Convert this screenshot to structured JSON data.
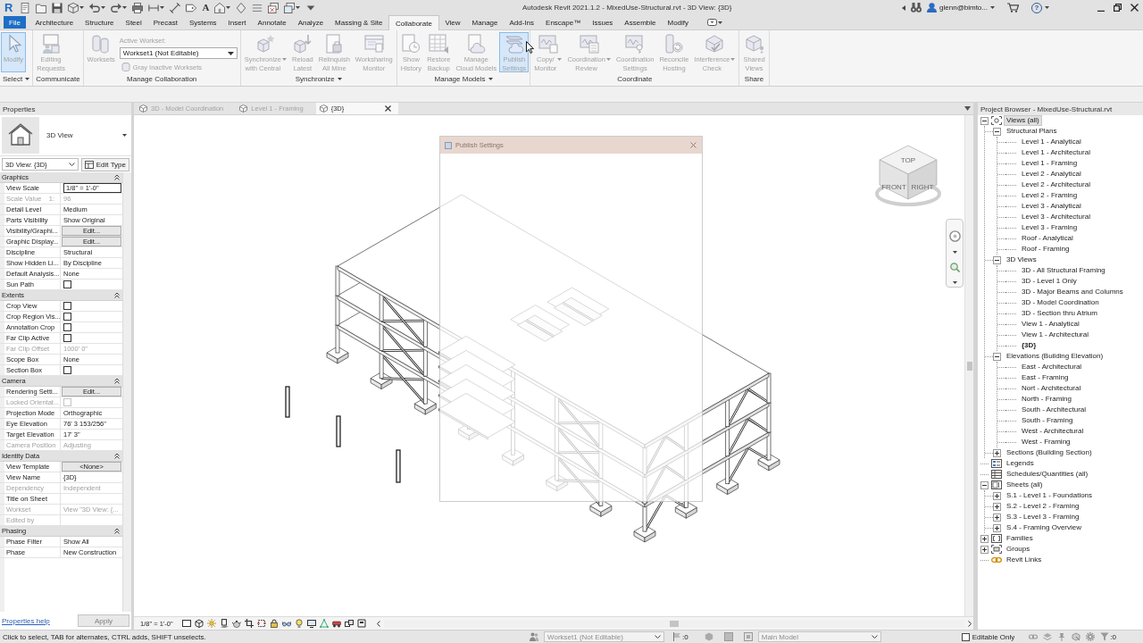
{
  "title_bar": {
    "logo": "R",
    "quick_access": [
      {
        "kind": "recent",
        "menu": false
      },
      {
        "kind": "open",
        "menu": false
      },
      {
        "kind": "save",
        "menu": false
      },
      {
        "kind": "sync",
        "menu": true
      },
      {
        "kind": "undo",
        "menu": true
      },
      {
        "kind": "redo",
        "menu": true
      },
      {
        "kind": "print",
        "menu": false
      },
      {
        "kind": "measure",
        "menu": true
      },
      {
        "kind": "dimension",
        "menu": false
      },
      {
        "kind": "tag",
        "menu": false
      },
      {
        "kind": "text",
        "glyph": "A",
        "menu": false
      },
      {
        "kind": "view3d",
        "menu": true
      },
      {
        "kind": "section",
        "menu": false
      },
      {
        "kind": "thinlines",
        "menu": false
      },
      {
        "kind": "closewindows",
        "menu": false
      },
      {
        "kind": "switchwindows",
        "menu": true
      },
      {
        "kind": "customize",
        "menu": false
      }
    ],
    "title": "Autodesk Revit 2021.1.2 - MixedUse-Structural.rvt - 3D View: {3D}",
    "user": "glenn@bimto...",
    "help": "?"
  },
  "ribbon": {
    "tabs": [
      {
        "label": "File",
        "kind": "app",
        "selected": false
      },
      {
        "label": "Architecture",
        "kind": "tab",
        "selected": false
      },
      {
        "label": "Structure",
        "kind": "tab",
        "selected": false
      },
      {
        "label": "Steel",
        "kind": "tab",
        "selected": false
      },
      {
        "label": "Precast",
        "kind": "tab",
        "selected": false
      },
      {
        "label": "Systems",
        "kind": "tab",
        "selected": false
      },
      {
        "label": "Insert",
        "kind": "tab",
        "selected": false
      },
      {
        "label": "Annotate",
        "kind": "tab",
        "selected": false
      },
      {
        "label": "Analyze",
        "kind": "tab",
        "selected": false
      },
      {
        "label": "Massing & Site",
        "kind": "tab",
        "selected": false
      },
      {
        "label": "Collaborate",
        "kind": "tab",
        "selected": true
      },
      {
        "label": "View",
        "kind": "tab",
        "selected": false
      },
      {
        "label": "Manage",
        "kind": "tab",
        "selected": false
      },
      {
        "label": "Add-Ins",
        "kind": "tab",
        "selected": false
      },
      {
        "label": "Enscape™",
        "kind": "tab",
        "selected": false
      },
      {
        "label": "Issues",
        "kind": "tab",
        "selected": false
      },
      {
        "label": "Assemble",
        "kind": "tab",
        "selected": false
      },
      {
        "label": "Modify",
        "kind": "tab",
        "selected": false
      }
    ],
    "panels": [
      {
        "label": "Select",
        "menu": true,
        "buttons": [
          {
            "label": "Modify",
            "kind": "large",
            "disabled": true,
            "highlighted": true,
            "menu": false
          }
        ]
      },
      {
        "label": "Communicate",
        "menu": false,
        "buttons": [
          {
            "label": "Editing\nRequests",
            "kind": "large",
            "disabled": true,
            "highlighted": false,
            "menu": false
          }
        ]
      },
      {
        "label": "Manage Collaboration",
        "menu": false,
        "buttons": [
          {
            "label": "Worksets",
            "kind": "large",
            "disabled": true,
            "highlighted": false,
            "menu": false
          },
          {
            "label": "Active Workset:",
            "kind": "caption",
            "disabled": true,
            "highlighted": false,
            "menu": false
          },
          {
            "label": "Workset1 (Not Editable)",
            "kind": "dropdown",
            "disabled": false,
            "highlighted": false,
            "menu": true
          },
          {
            "label": "Gray Inactive Worksets",
            "kind": "small",
            "disabled": true,
            "highlighted": false,
            "menu": false
          }
        ]
      },
      {
        "label": "Synchronize",
        "menu": true,
        "buttons": [
          {
            "label": "Synchronize\nwith Central",
            "kind": "large",
            "disabled": true,
            "highlighted": false,
            "menu": true
          },
          {
            "label": "Reload\nLatest",
            "kind": "large",
            "disabled": true,
            "highlighted": false,
            "menu": false
          },
          {
            "label": "Relinquish\nAll Mine",
            "kind": "large",
            "disabled": true,
            "highlighted": false,
            "menu": false
          },
          {
            "label": "Worksharing\nMonitor",
            "kind": "large",
            "disabled": true,
            "highlighted": false,
            "menu": false
          }
        ]
      },
      {
        "label": "Manage Models",
        "menu": true,
        "buttons": [
          {
            "label": "Show\nHistory",
            "kind": "large",
            "disabled": true,
            "highlighted": false,
            "menu": false
          },
          {
            "label": "Restore\nBackup",
            "kind": "large",
            "disabled": true,
            "highlighted": false,
            "menu": false
          },
          {
            "label": "Manage\nCloud Models",
            "kind": "large",
            "disabled": true,
            "highlighted": false,
            "menu": false
          },
          {
            "label": "Publish\nSettings",
            "kind": "large",
            "disabled": true,
            "highlighted": true,
            "menu": false
          }
        ]
      },
      {
        "label": "Coordinate",
        "menu": false,
        "buttons": [
          {
            "label": "Copy/\nMonitor",
            "kind": "large",
            "disabled": true,
            "highlighted": false,
            "menu": true
          },
          {
            "label": "Coordination\nReview",
            "kind": "large",
            "disabled": true,
            "highlighted": false,
            "menu": true
          },
          {
            "label": "Coordination\nSettings",
            "kind": "large",
            "disabled": true,
            "highlighted": false,
            "menu": false
          },
          {
            "label": "Reconcile\nHosting",
            "kind": "large",
            "disabled": true,
            "highlighted": false,
            "menu": false
          },
          {
            "label": "Interference\nCheck",
            "kind": "large",
            "disabled": true,
            "highlighted": false,
            "menu": true
          }
        ]
      },
      {
        "label": "Share",
        "menu": false,
        "buttons": [
          {
            "label": "Shared\nViews",
            "kind": "large",
            "disabled": true,
            "highlighted": false,
            "menu": false
          }
        ]
      }
    ]
  },
  "properties": {
    "title": "Properties",
    "type_name": "3D View",
    "instance": "3D View: {3D}",
    "edit_type": "Edit Type",
    "groups": [
      {
        "name": "Graphics",
        "expanded": true,
        "rows": [
          {
            "name": "View Scale",
            "kind": "field",
            "value": "1/8\" = 1'-0\"",
            "disabled": false
          },
          {
            "name": "Scale Value    1:",
            "kind": "text",
            "value": "96",
            "disabled": true
          },
          {
            "name": "Detail Level",
            "kind": "text",
            "value": "Medium",
            "disabled": false
          },
          {
            "name": "Parts Visibility",
            "kind": "text",
            "value": "Show Original",
            "disabled": false
          },
          {
            "name": "Visibility/Graphi...",
            "kind": "button",
            "value": "Edit...",
            "disabled": false
          },
          {
            "name": "Graphic Display...",
            "kind": "button",
            "value": "Edit...",
            "disabled": false
          },
          {
            "name": "Discipline",
            "kind": "text",
            "value": "Structural",
            "disabled": false
          },
          {
            "name": "Show Hidden Li...",
            "kind": "text",
            "value": "By Discipline",
            "disabled": false
          },
          {
            "name": "Default Analysis...",
            "kind": "text",
            "value": "None",
            "disabled": false
          },
          {
            "name": "Sun Path",
            "kind": "checkbox",
            "checked": false,
            "disabled": false
          }
        ]
      },
      {
        "name": "Extents",
        "expanded": true,
        "rows": [
          {
            "name": "Crop View",
            "kind": "checkbox",
            "checked": false,
            "disabled": false
          },
          {
            "name": "Crop Region Vis...",
            "kind": "checkbox",
            "checked": false,
            "disabled": false
          },
          {
            "name": "Annotation Crop",
            "kind": "checkbox",
            "checked": false,
            "disabled": false
          },
          {
            "name": "Far Clip Active",
            "kind": "checkbox",
            "checked": false,
            "disabled": false
          },
          {
            "name": "Far Clip Offset",
            "kind": "text",
            "value": "1000' 0\"",
            "disabled": true
          },
          {
            "name": "Scope Box",
            "kind": "text",
            "value": "None",
            "disabled": false
          },
          {
            "name": "Section Box",
            "kind": "checkbox",
            "checked": false,
            "disabled": false
          }
        ]
      },
      {
        "name": "Camera",
        "expanded": true,
        "rows": [
          {
            "name": "Rendering Setti...",
            "kind": "button",
            "value": "Edit...",
            "disabled": false
          },
          {
            "name": "Locked Orientat...",
            "kind": "checkbox",
            "checked": false,
            "disabled": true
          },
          {
            "name": "Projection Mode",
            "kind": "text",
            "value": "Orthographic",
            "disabled": false
          },
          {
            "name": "Eye Elevation",
            "kind": "text",
            "value": "76' 3 153/256\"",
            "disabled": false
          },
          {
            "name": "Target Elevation",
            "kind": "text",
            "value": "17' 3\"",
            "disabled": false
          },
          {
            "name": "Camera Position",
            "kind": "text",
            "value": "Adjusting",
            "disabled": true
          }
        ]
      },
      {
        "name": "Identity Data",
        "expanded": true,
        "rows": [
          {
            "name": "View Template",
            "kind": "button",
            "value": "<None>",
            "disabled": false
          },
          {
            "name": "View Name",
            "kind": "text",
            "value": "{3D}",
            "disabled": false
          },
          {
            "name": "Dependency",
            "kind": "text",
            "value": "Independent",
            "disabled": true
          },
          {
            "name": "Title on Sheet",
            "kind": "text",
            "disabled": false
          },
          {
            "name": "Workset",
            "kind": "text",
            "value": "View \"3D View: {...",
            "disabled": true
          },
          {
            "name": "Edited by",
            "kind": "text",
            "disabled": true
          }
        ]
      },
      {
        "name": "Phasing",
        "expanded": true,
        "rows": [
          {
            "name": "Phase Filter",
            "kind": "text",
            "value": "Show All",
            "disabled": false
          },
          {
            "name": "Phase",
            "kind": "text",
            "value": "New Construction",
            "disabled": false
          }
        ]
      }
    ],
    "help_link": "Properties help",
    "apply": {
      "label": "Apply",
      "disabled": true
    }
  },
  "view": {
    "tabs": [
      {
        "label": "3D - Model Coordination",
        "selected": false
      },
      {
        "label": "Level 1 - Framing",
        "selected": false
      },
      {
        "label": "{3D}",
        "selected": true
      }
    ],
    "dialog": {
      "title": "Publish Settings"
    },
    "view_cube": {
      "faces": [
        "TOP",
        "FRONT",
        "RIGHT"
      ]
    },
    "scale": "1/8\" = 1'-0\""
  },
  "project_browser": {
    "title": "Project Browser - MixedUse-Structural.rvt",
    "tree": [
      {
        "label": "Views (all)",
        "kind": "views",
        "expanded": true,
        "selected": true,
        "current": false,
        "children": [
          {
            "label": "Structural Plans",
            "expanded": true,
            "selected": false,
            "current": false,
            "children": [
              {
                "label": "Level 1 - Analytical",
                "selected": false,
                "current": false
              },
              {
                "label": "Level 1 - Architectural",
                "selected": false,
                "current": false
              },
              {
                "label": "Level 1 - Framing",
                "selected": false,
                "current": false
              },
              {
                "label": "Level 2 - Analytical",
                "selected": false,
                "current": false
              },
              {
                "label": "Level 2 - Architectural",
                "selected": false,
                "current": false
              },
              {
                "label": "Level 2 - Framing",
                "selected": false,
                "current": false
              },
              {
                "label": "Level 3 - Analytical",
                "selected": false,
                "current": false
              },
              {
                "label": "Level 3 - Architectural",
                "selected": false,
                "current": false
              },
              {
                "label": "Level 3 - Framing",
                "selected": false,
                "current": false
              },
              {
                "label": "Roof - Analytical",
                "selected": false,
                "current": false
              },
              {
                "label": "Roof - Framing",
                "selected": false,
                "current": false
              }
            ]
          },
          {
            "label": "3D Views",
            "expanded": true,
            "selected": false,
            "current": false,
            "children": [
              {
                "label": "3D - All Structural Framing",
                "selected": false,
                "current": false
              },
              {
                "label": "3D - Level 1 Only",
                "selected": false,
                "current": false
              },
              {
                "label": "3D - Major Beams and Columns",
                "selected": false,
                "current": false
              },
              {
                "label": "3D - Model Coordination",
                "selected": false,
                "current": false
              },
              {
                "label": "3D - Section thru Atrium",
                "selected": false,
                "current": false
              },
              {
                "label": "View 1 - Analytical",
                "selected": false,
                "current": false
              },
              {
                "label": "View 1 - Architectural",
                "selected": false,
                "current": false
              },
              {
                "label": "{3D}",
                "selected": false,
                "current": true
              }
            ]
          },
          {
            "label": "Elevations (Building Elevation)",
            "expanded": true,
            "selected": false,
            "current": false,
            "children": [
              {
                "label": "East - Architectural",
                "selected": false,
                "current": false
              },
              {
                "label": "East - Framing",
                "selected": false,
                "current": false
              },
              {
                "label": "Nort - Architectural",
                "selected": false,
                "current": false
              },
              {
                "label": "North - Framing",
                "selected": false,
                "current": false
              },
              {
                "label": "South - Architectural",
                "selected": false,
                "current": false
              },
              {
                "label": "South - Framing",
                "selected": false,
                "current": false
              },
              {
                "label": "West - Architectural",
                "selected": false,
                "current": false
              },
              {
                "label": "West - Framing",
                "selected": false,
                "current": false
              }
            ]
          },
          {
            "label": "Sections (Building Section)",
            "expanded": false,
            "selected": false,
            "current": false
          }
        ]
      },
      {
        "label": "Legends",
        "kind": "legends",
        "selected": false,
        "current": false
      },
      {
        "label": "Schedules/Quantities (all)",
        "kind": "schedules",
        "selected": false,
        "current": false
      },
      {
        "label": "Sheets (all)",
        "kind": "sheets",
        "expanded": true,
        "selected": false,
        "current": false,
        "children": [
          {
            "label": "S.1 - Level 1 - Foundations",
            "expanded": false,
            "selected": false,
            "current": false
          },
          {
            "label": "S.2 - Level 2 - Framing",
            "expanded": false,
            "selected": false,
            "current": false
          },
          {
            "label": "S.3 - Level 3 - Framing",
            "expanded": false,
            "selected": false,
            "current": false
          },
          {
            "label": "S.4 - Framing Overview",
            "expanded": false,
            "selected": false,
            "current": false
          }
        ]
      },
      {
        "label": "Families",
        "kind": "families",
        "expanded": false,
        "selected": false,
        "current": false
      },
      {
        "label": "Groups",
        "kind": "groups",
        "expanded": false,
        "selected": false,
        "current": false
      },
      {
        "label": "Revit Links",
        "kind": "links",
        "selected": false,
        "current": false
      }
    ]
  },
  "status_bar": {
    "message": "Click to select, TAB for alternates, CTRL adds, SHIFT unselects.",
    "workset": {
      "value": "Workset1 (Not Editable)",
      "disabled": true
    },
    "editable_requests": ":0",
    "design_option": {
      "value": "Main Model",
      "disabled": true
    },
    "editable_only": {
      "label": "Editable Only",
      "checked": false
    },
    "filter_count": ":0"
  }
}
